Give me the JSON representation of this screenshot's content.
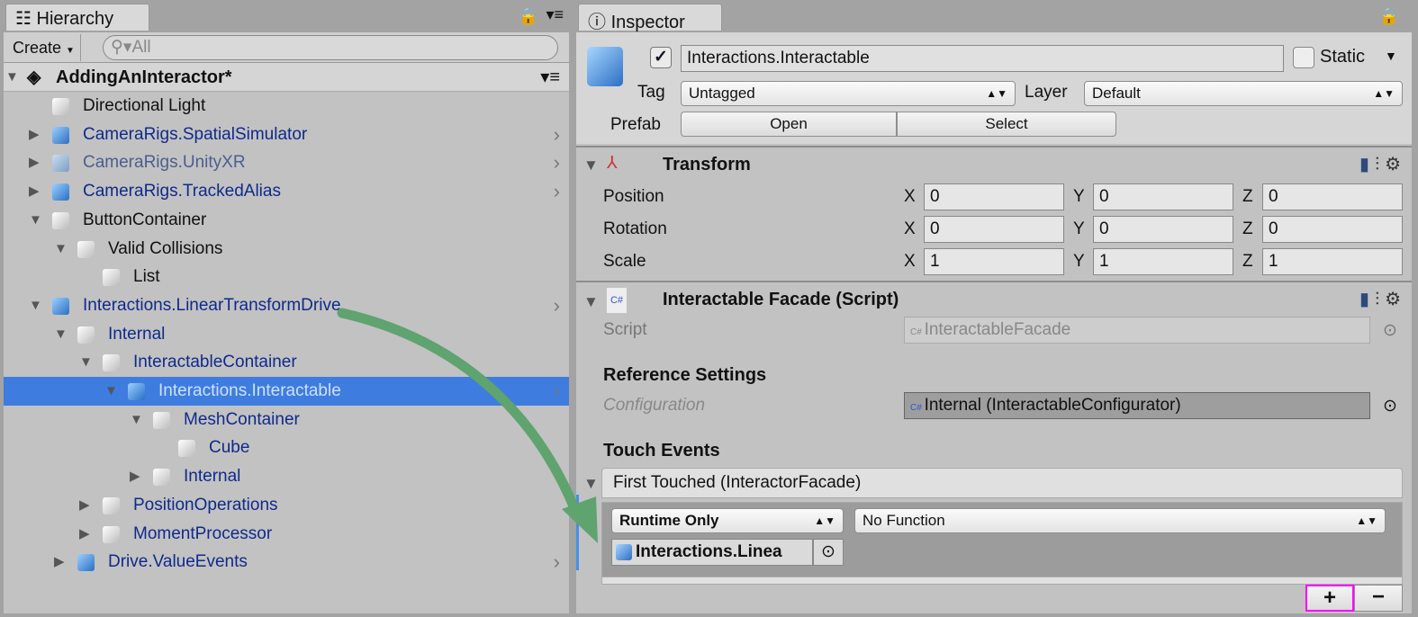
{
  "hierarchy": {
    "tab": "Hierarchy",
    "create": "Create",
    "search_placeholder": "All",
    "scene": "AddingAnInteractor*",
    "items": [
      {
        "label": "Directional Light",
        "depth": 0,
        "toggle": "none",
        "prefab": false,
        "style": "normal"
      },
      {
        "label": "CameraRigs.SpatialSimulator",
        "depth": 0,
        "toggle": "collapsed",
        "prefab": true,
        "style": "prefab"
      },
      {
        "label": "CameraRigs.UnityXR",
        "depth": 0,
        "toggle": "collapsed",
        "prefab": true,
        "style": "faded"
      },
      {
        "label": "CameraRigs.TrackedAlias",
        "depth": 0,
        "toggle": "collapsed",
        "prefab": true,
        "style": "prefab"
      },
      {
        "label": "ButtonContainer",
        "depth": 0,
        "toggle": "expanded",
        "prefab": false,
        "style": "normal"
      },
      {
        "label": "Valid Collisions",
        "depth": 1,
        "toggle": "expanded",
        "prefab": false,
        "style": "normal"
      },
      {
        "label": "List",
        "depth": 2,
        "toggle": "none",
        "prefab": false,
        "style": "normal"
      },
      {
        "label": "Interactions.LinearTransformDrive",
        "depth": 0,
        "toggle": "expanded",
        "prefab": true,
        "style": "prefab",
        "chevron": true
      },
      {
        "label": "Internal",
        "depth": 1,
        "toggle": "expanded",
        "prefab": false,
        "style": "prefab"
      },
      {
        "label": "InteractableContainer",
        "depth": 2,
        "toggle": "expanded",
        "prefab": false,
        "style": "prefab"
      },
      {
        "label": "Interactions.Interactable",
        "depth": 3,
        "toggle": "expanded",
        "prefab": true,
        "style": "selected",
        "chevron": true
      },
      {
        "label": "MeshContainer",
        "depth": 4,
        "toggle": "expanded",
        "prefab": false,
        "style": "prefab"
      },
      {
        "label": "Cube",
        "depth": 5,
        "toggle": "none",
        "prefab": false,
        "style": "prefab"
      },
      {
        "label": "Internal",
        "depth": 4,
        "toggle": "collapsed",
        "prefab": false,
        "style": "prefab"
      },
      {
        "label": "PositionOperations",
        "depth": 2,
        "toggle": "collapsed",
        "prefab": false,
        "style": "prefab"
      },
      {
        "label": "MomentProcessor",
        "depth": 2,
        "toggle": "collapsed",
        "prefab": false,
        "style": "prefab"
      },
      {
        "label": "Drive.ValueEvents",
        "depth": 1,
        "toggle": "collapsed",
        "prefab": true,
        "style": "prefab",
        "chevron": true
      }
    ]
  },
  "inspector": {
    "tab": "Inspector",
    "name": "Interactions.Interactable",
    "active": true,
    "static_label": "Static",
    "static": false,
    "tag_label": "Tag",
    "tag": "Untagged",
    "layer_label": "Layer",
    "layer": "Default",
    "prefab_label": "Prefab",
    "open": "Open",
    "select": "Select",
    "transform": {
      "title": "Transform",
      "rows": [
        {
          "label": "Position",
          "x": "0",
          "y": "0",
          "z": "0"
        },
        {
          "label": "Rotation",
          "x": "0",
          "y": "0",
          "z": "0"
        },
        {
          "label": "Scale",
          "x": "1",
          "y": "1",
          "z": "1"
        }
      ]
    },
    "facade": {
      "title": "Interactable Facade (Script)",
      "script_label": "Script",
      "script": "InteractableFacade",
      "ref_header": "Reference Settings",
      "config_label": "Configuration",
      "config": "Internal (InteractableConfigurator)",
      "touch_header": "Touch Events",
      "event_title": "First Touched (InteractorFacade)",
      "runtime": "Runtime Only",
      "function": "No Function",
      "target": "Interactions.Linea",
      "add": "+",
      "remove": "−"
    }
  },
  "colors": {
    "selection": "#3e7ce0",
    "prefab_text": "#0f2a8c",
    "arrow": "#5fa36f",
    "highlight": "#ff00ff"
  }
}
